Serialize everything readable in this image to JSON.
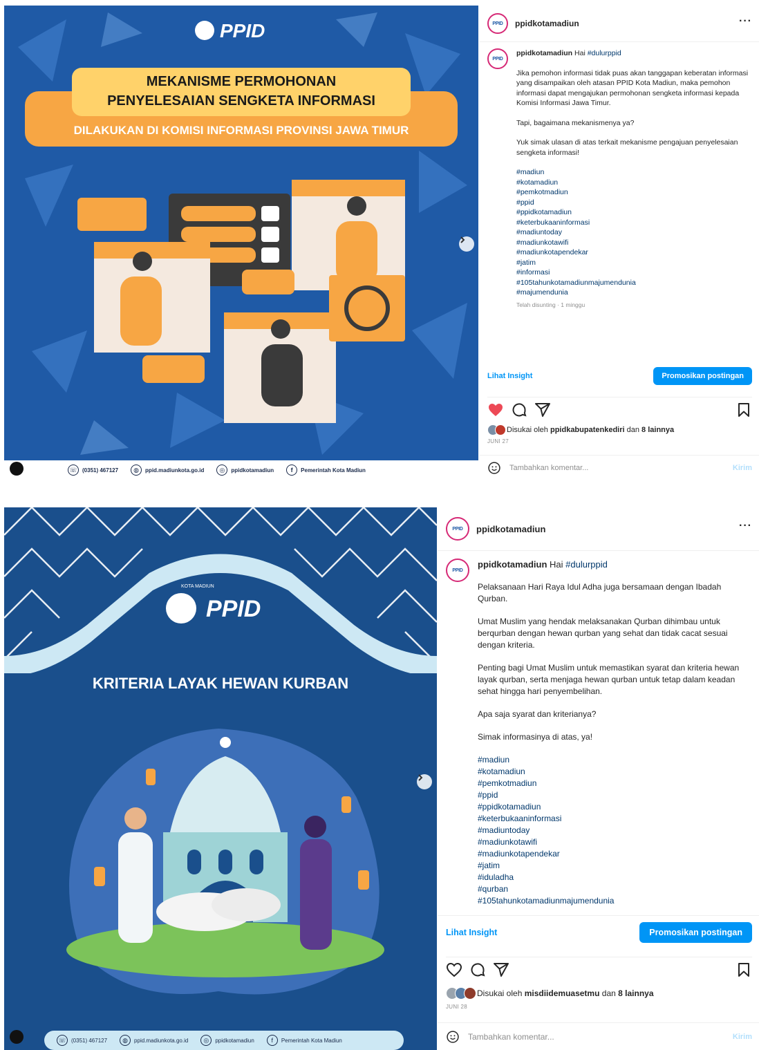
{
  "posts": [
    {
      "username": "ppidkotamadiun",
      "avatar_text": "PPID",
      "image": {
        "brand": "PPID",
        "title_line1": "MEKANISME PERMOHONAN",
        "title_line2": "PENYELESAIAN SENGKETA INFORMASI",
        "subtitle": "DILAKUKAN DI KOMISI INFORMASI PROVINSI JAWA TIMUR",
        "footer": {
          "phone": "(0351) 467127",
          "web": "ppid.madiunkota.go.id",
          "ig": "ppidkotamadiun",
          "fb": "Pemerintah Kota Madiun"
        }
      },
      "caption": {
        "username": "ppidkotamadiun",
        "greeting": "Hai",
        "greeting_tag": "#dulurppid",
        "paragraphs": [
          "Jika pemohon informasi tidak puas akan tanggapan keberatan informasi yang disampaikan oleh atasan PPID Kota Madiun, maka pemohon informasi dapat mengajukan permohonan sengketa informasi kepada Komisi Informasi Jawa Timur.",
          "Tapi, bagaimana mekanismenya ya?",
          "Yuk simak ulasan di atas terkait mekanisme pengajuan penyelesaian sengketa informasi!"
        ],
        "hashtags": [
          "#madiun",
          "#kotamadiun",
          "#pemkotmadiun",
          "#ppid",
          "#ppidkotamadiun",
          "#keterbukaaninformasi",
          "#madiuntoday",
          "#madiunkotawifi",
          "#madiunkotapendekar",
          "#jatim",
          "#informasi",
          "#105tahunkotamadiunmajumendunia",
          "#majumendunia"
        ],
        "edited": "Telah disunting · 1 minggu"
      },
      "insight_label": "Lihat Insight",
      "promote_label": "Promosikan postingan",
      "liked": true,
      "likes": {
        "prefix": "Disukai oleh",
        "user": "ppidkabupatenkediri",
        "middle": "dan",
        "others": "8 lainnya"
      },
      "date": "JUNI 27",
      "comment_placeholder": "Tambahkan komentar...",
      "send_label": "Kirim"
    },
    {
      "username": "ppidkotamadiun",
      "avatar_text": "PPID",
      "image": {
        "brand": "PPID",
        "city_label": "KOTA MADIUN",
        "title": "KRITERIA LAYAK HEWAN KURBAN",
        "footer": {
          "phone": "(0351) 467127",
          "web": "ppid.madiunkota.go.id",
          "ig": "ppidkotamadiun",
          "fb": "Pemerintah Kota Madiun"
        }
      },
      "caption": {
        "username": "ppidkotamadiun",
        "greeting": "Hai",
        "greeting_tag": "#dulurppid",
        "paragraphs": [
          "Pelaksanaan Hari Raya Idul Adha juga bersamaan dengan Ibadah Qurban.",
          "Umat Muslim yang hendak melaksanakan Qurban dihimbau untuk berqurban dengan hewan qurban yang sehat dan tidak cacat sesuai dengan kriteria.",
          "Penting bagi Umat Muslim untuk memastikan syarat dan kriteria hewan layak qurban, serta menjaga hewan qurban untuk tetap dalam keadan sehat hingga hari penyembelihan.",
          "Apa saja syarat dan kriterianya?",
          "Simak informasinya di atas, ya!"
        ],
        "hashtags": [
          "#madiun",
          "#kotamadiun",
          "#pemkotmadiun",
          "#ppid",
          "#ppidkotamadiun",
          "#keterbukaaninformasi",
          "#madiuntoday",
          "#madiunkotawifi",
          "#madiunkotapendekar",
          "#jatim",
          "#iduladha",
          "#qurban",
          "#105tahunkotamadiunmajumendunia"
        ]
      },
      "insight_label": "Lihat Insight",
      "promote_label": "Promosikan postingan",
      "liked": false,
      "likes": {
        "prefix": "Disukai oleh",
        "user": "misdiidemuasetmu",
        "middle": "dan",
        "others": "8 lainnya"
      },
      "date": "JUNI 28",
      "comment_placeholder": "Tambahkan komentar...",
      "send_label": "Kirim"
    }
  ],
  "colors": {
    "accent": "#0095f6",
    "like": "#ed4956",
    "link": "#00376b",
    "poster1_bg": "#1f5aa6",
    "poster2_bg": "#1a4f8c",
    "banner_orange": "#f7a644",
    "banner_yellow": "#ffd26a"
  },
  "icons": [
    "heart-icon",
    "comment-icon",
    "share-icon",
    "bookmark-icon",
    "emoji-icon",
    "more-icon",
    "next-arrow-icon"
  ]
}
